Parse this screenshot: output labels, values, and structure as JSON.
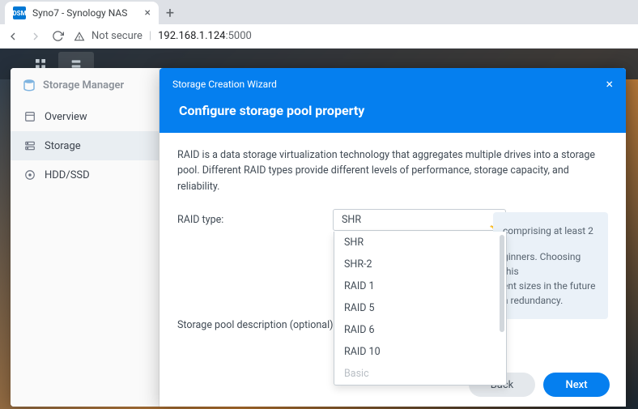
{
  "browser": {
    "tab_title": "Syno7 - Synology NAS",
    "favicon_text": "DSM",
    "security_label": "Not secure",
    "url_host": "192.168.1.124",
    "url_port": ":5000"
  },
  "storage_manager": {
    "title": "Storage Manager",
    "nav": [
      {
        "label": "Overview",
        "icon": "overview-icon"
      },
      {
        "label": "Storage",
        "icon": "storage-icon"
      },
      {
        "label": "HDD/SSD",
        "icon": "hdd-icon"
      }
    ]
  },
  "wizard": {
    "title": "Storage Creation Wizard",
    "heading": "Configure storage pool property",
    "intro": "RAID is a data storage virtualization technology that aggregates multiple drives into a storage pool. Different RAID types provide different levels of performance, storage capacity, and reliability.",
    "raid_label": "RAID type:",
    "raid_selected": "SHR",
    "raid_options": [
      "SHR",
      "SHR-2",
      "RAID 1",
      "RAID 5",
      "RAID 6",
      "RAID 10",
      "Basic"
    ],
    "hint_line1": "comprising at least 2",
    "hint_line2": "ginners. Choosing this",
    "hint_line3": "ent sizes in the future",
    "hint_line4": "a redundancy.",
    "desc_label": "Storage pool description (optional):",
    "back_label": "Back",
    "next_label": "Next"
  }
}
